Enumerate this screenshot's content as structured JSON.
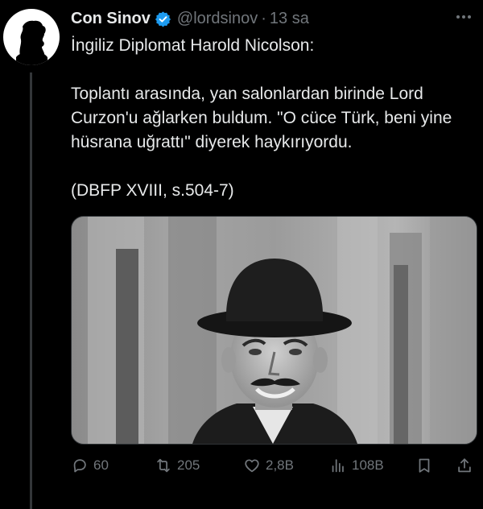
{
  "tweet": {
    "author_name": "Con Sinov",
    "handle": "@lordsinov",
    "separator": "·",
    "time": "13 sa",
    "lines": {
      "intro": "İngiliz Diplomat Harold Nicolson:",
      "quote": "Toplantı arasında, yan salonlardan birinde Lord Curzon'u ağlarken buldum. \"O cüce Türk, beni yine hüsrana uğrattı\" diyerek haykırıyordu.",
      "source": "(DBFP XVIII, s.504-7)"
    },
    "verified_color": "#1d9bf0"
  },
  "actions": {
    "replies": "60",
    "retweets": "205",
    "likes": "2,8B",
    "views": "108B"
  },
  "icons": [
    "verified-badge-icon",
    "more-icon",
    "reply-icon",
    "retweet-icon",
    "like-icon",
    "views-icon",
    "bookmark-icon",
    "share-icon"
  ]
}
